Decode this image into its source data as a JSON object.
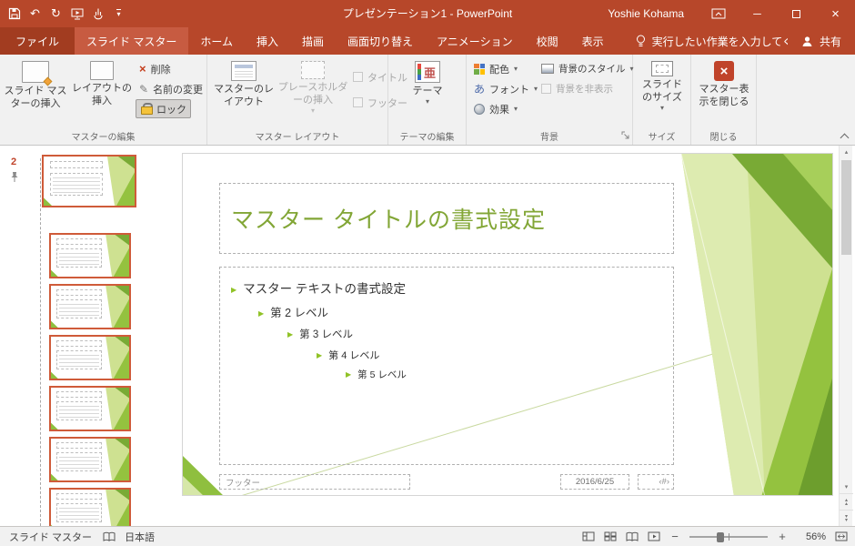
{
  "titlebar": {
    "title": "プレゼンテーション1 - PowerPoint",
    "user": "Yoshie Kohama"
  },
  "tabs": {
    "file": "ファイル",
    "slide_master": "スライド マスター",
    "home": "ホーム",
    "insert": "挿入",
    "draw": "描画",
    "transitions": "画面切り替え",
    "animations": "アニメーション",
    "review": "校閲",
    "view": "表示",
    "tellme": "実行したい作業を入力してください",
    "share": "共有"
  },
  "ribbon": {
    "insert_slide_master": "スライド マスターの挿入",
    "insert_layout": "レイアウトの挿入",
    "delete_btn": "削除",
    "rename": "名前の変更",
    "lock": "ロック",
    "group_edit_master": "マスターの編集",
    "master_layout": "マスターのレイアウト",
    "insert_placeholder": "プレースホルダーの挿入",
    "title_checkbox": "タイトル",
    "footer_checkbox": "フッター",
    "group_master_layout": "マスター レイアウト",
    "themes": "テーマ",
    "group_edit_theme": "テーマの編集",
    "colors": "配色",
    "fonts": "フォント",
    "effects": "効果",
    "background_styles": "背景のスタイル",
    "hide_background": "背景を非表示",
    "group_background": "背景",
    "slide_size": "スライドのサイズ",
    "group_size": "サイズ",
    "close_master": "マスター表示を閉じる",
    "group_close": "閉じる"
  },
  "thumbnails": {
    "master_number": "2"
  },
  "slide": {
    "title": "マスター タイトルの書式設定",
    "body": [
      "マスター テキストの書式設定",
      "第 2 レベル",
      "第 3 レベル",
      "第 4 レベル",
      "第 5 レベル"
    ],
    "footer": "フッター",
    "date": "2016/6/25",
    "number": "‹#›"
  },
  "statusbar": {
    "view_name": "スライド マスター",
    "language": "日本語",
    "zoom": "56%"
  },
  "icons": {
    "caret_down": "▾",
    "bullet": "▶",
    "close_x": "×",
    "delete_x": "×",
    "undo": "↶",
    "redo": "↻",
    "pencil": "✎",
    "theme_char": "亜",
    "font_char": "あ",
    "minimize": "─",
    "zoom_out": "−",
    "zoom_in": "+",
    "scroll_up": "▴",
    "scroll_down": "▾"
  }
}
